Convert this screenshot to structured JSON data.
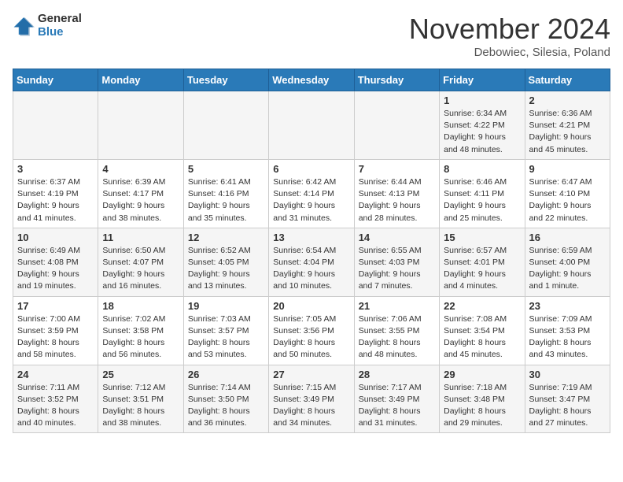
{
  "logo": {
    "general": "General",
    "blue": "Blue"
  },
  "title": "November 2024",
  "location": "Debowiec, Silesia, Poland",
  "days_of_week": [
    "Sunday",
    "Monday",
    "Tuesday",
    "Wednesday",
    "Thursday",
    "Friday",
    "Saturday"
  ],
  "weeks": [
    [
      {
        "day": "",
        "info": ""
      },
      {
        "day": "",
        "info": ""
      },
      {
        "day": "",
        "info": ""
      },
      {
        "day": "",
        "info": ""
      },
      {
        "day": "",
        "info": ""
      },
      {
        "day": "1",
        "info": "Sunrise: 6:34 AM\nSunset: 4:22 PM\nDaylight: 9 hours\nand 48 minutes."
      },
      {
        "day": "2",
        "info": "Sunrise: 6:36 AM\nSunset: 4:21 PM\nDaylight: 9 hours\nand 45 minutes."
      }
    ],
    [
      {
        "day": "3",
        "info": "Sunrise: 6:37 AM\nSunset: 4:19 PM\nDaylight: 9 hours\nand 41 minutes."
      },
      {
        "day": "4",
        "info": "Sunrise: 6:39 AM\nSunset: 4:17 PM\nDaylight: 9 hours\nand 38 minutes."
      },
      {
        "day": "5",
        "info": "Sunrise: 6:41 AM\nSunset: 4:16 PM\nDaylight: 9 hours\nand 35 minutes."
      },
      {
        "day": "6",
        "info": "Sunrise: 6:42 AM\nSunset: 4:14 PM\nDaylight: 9 hours\nand 31 minutes."
      },
      {
        "day": "7",
        "info": "Sunrise: 6:44 AM\nSunset: 4:13 PM\nDaylight: 9 hours\nand 28 minutes."
      },
      {
        "day": "8",
        "info": "Sunrise: 6:46 AM\nSunset: 4:11 PM\nDaylight: 9 hours\nand 25 minutes."
      },
      {
        "day": "9",
        "info": "Sunrise: 6:47 AM\nSunset: 4:10 PM\nDaylight: 9 hours\nand 22 minutes."
      }
    ],
    [
      {
        "day": "10",
        "info": "Sunrise: 6:49 AM\nSunset: 4:08 PM\nDaylight: 9 hours\nand 19 minutes."
      },
      {
        "day": "11",
        "info": "Sunrise: 6:50 AM\nSunset: 4:07 PM\nDaylight: 9 hours\nand 16 minutes."
      },
      {
        "day": "12",
        "info": "Sunrise: 6:52 AM\nSunset: 4:05 PM\nDaylight: 9 hours\nand 13 minutes."
      },
      {
        "day": "13",
        "info": "Sunrise: 6:54 AM\nSunset: 4:04 PM\nDaylight: 9 hours\nand 10 minutes."
      },
      {
        "day": "14",
        "info": "Sunrise: 6:55 AM\nSunset: 4:03 PM\nDaylight: 9 hours\nand 7 minutes."
      },
      {
        "day": "15",
        "info": "Sunrise: 6:57 AM\nSunset: 4:01 PM\nDaylight: 9 hours\nand 4 minutes."
      },
      {
        "day": "16",
        "info": "Sunrise: 6:59 AM\nSunset: 4:00 PM\nDaylight: 9 hours\nand 1 minute."
      }
    ],
    [
      {
        "day": "17",
        "info": "Sunrise: 7:00 AM\nSunset: 3:59 PM\nDaylight: 8 hours\nand 58 minutes."
      },
      {
        "day": "18",
        "info": "Sunrise: 7:02 AM\nSunset: 3:58 PM\nDaylight: 8 hours\nand 56 minutes."
      },
      {
        "day": "19",
        "info": "Sunrise: 7:03 AM\nSunset: 3:57 PM\nDaylight: 8 hours\nand 53 minutes."
      },
      {
        "day": "20",
        "info": "Sunrise: 7:05 AM\nSunset: 3:56 PM\nDaylight: 8 hours\nand 50 minutes."
      },
      {
        "day": "21",
        "info": "Sunrise: 7:06 AM\nSunset: 3:55 PM\nDaylight: 8 hours\nand 48 minutes."
      },
      {
        "day": "22",
        "info": "Sunrise: 7:08 AM\nSunset: 3:54 PM\nDaylight: 8 hours\nand 45 minutes."
      },
      {
        "day": "23",
        "info": "Sunrise: 7:09 AM\nSunset: 3:53 PM\nDaylight: 8 hours\nand 43 minutes."
      }
    ],
    [
      {
        "day": "24",
        "info": "Sunrise: 7:11 AM\nSunset: 3:52 PM\nDaylight: 8 hours\nand 40 minutes."
      },
      {
        "day": "25",
        "info": "Sunrise: 7:12 AM\nSunset: 3:51 PM\nDaylight: 8 hours\nand 38 minutes."
      },
      {
        "day": "26",
        "info": "Sunrise: 7:14 AM\nSunset: 3:50 PM\nDaylight: 8 hours\nand 36 minutes."
      },
      {
        "day": "27",
        "info": "Sunrise: 7:15 AM\nSunset: 3:49 PM\nDaylight: 8 hours\nand 34 minutes."
      },
      {
        "day": "28",
        "info": "Sunrise: 7:17 AM\nSunset: 3:49 PM\nDaylight: 8 hours\nand 31 minutes."
      },
      {
        "day": "29",
        "info": "Sunrise: 7:18 AM\nSunset: 3:48 PM\nDaylight: 8 hours\nand 29 minutes."
      },
      {
        "day": "30",
        "info": "Sunrise: 7:19 AM\nSunset: 3:47 PM\nDaylight: 8 hours\nand 27 minutes."
      }
    ]
  ]
}
